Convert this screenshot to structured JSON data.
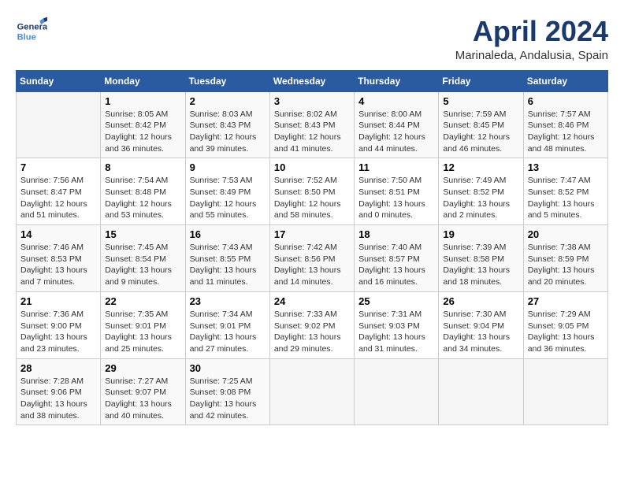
{
  "header": {
    "logo_general": "General",
    "logo_blue": "Blue",
    "month_title": "April 2024",
    "location": "Marinaleda, Andalusia, Spain"
  },
  "columns": [
    "Sunday",
    "Monday",
    "Tuesday",
    "Wednesday",
    "Thursday",
    "Friday",
    "Saturday"
  ],
  "weeks": [
    [
      {
        "day": "",
        "info": ""
      },
      {
        "day": "1",
        "info": "Sunrise: 8:05 AM\nSunset: 8:42 PM\nDaylight: 12 hours\nand 36 minutes."
      },
      {
        "day": "2",
        "info": "Sunrise: 8:03 AM\nSunset: 8:43 PM\nDaylight: 12 hours\nand 39 minutes."
      },
      {
        "day": "3",
        "info": "Sunrise: 8:02 AM\nSunset: 8:43 PM\nDaylight: 12 hours\nand 41 minutes."
      },
      {
        "day": "4",
        "info": "Sunrise: 8:00 AM\nSunset: 8:44 PM\nDaylight: 12 hours\nand 44 minutes."
      },
      {
        "day": "5",
        "info": "Sunrise: 7:59 AM\nSunset: 8:45 PM\nDaylight: 12 hours\nand 46 minutes."
      },
      {
        "day": "6",
        "info": "Sunrise: 7:57 AM\nSunset: 8:46 PM\nDaylight: 12 hours\nand 48 minutes."
      }
    ],
    [
      {
        "day": "7",
        "info": "Sunrise: 7:56 AM\nSunset: 8:47 PM\nDaylight: 12 hours\nand 51 minutes."
      },
      {
        "day": "8",
        "info": "Sunrise: 7:54 AM\nSunset: 8:48 PM\nDaylight: 12 hours\nand 53 minutes."
      },
      {
        "day": "9",
        "info": "Sunrise: 7:53 AM\nSunset: 8:49 PM\nDaylight: 12 hours\nand 55 minutes."
      },
      {
        "day": "10",
        "info": "Sunrise: 7:52 AM\nSunset: 8:50 PM\nDaylight: 12 hours\nand 58 minutes."
      },
      {
        "day": "11",
        "info": "Sunrise: 7:50 AM\nSunset: 8:51 PM\nDaylight: 13 hours\nand 0 minutes."
      },
      {
        "day": "12",
        "info": "Sunrise: 7:49 AM\nSunset: 8:52 PM\nDaylight: 13 hours\nand 2 minutes."
      },
      {
        "day": "13",
        "info": "Sunrise: 7:47 AM\nSunset: 8:52 PM\nDaylight: 13 hours\nand 5 minutes."
      }
    ],
    [
      {
        "day": "14",
        "info": "Sunrise: 7:46 AM\nSunset: 8:53 PM\nDaylight: 13 hours\nand 7 minutes."
      },
      {
        "day": "15",
        "info": "Sunrise: 7:45 AM\nSunset: 8:54 PM\nDaylight: 13 hours\nand 9 minutes."
      },
      {
        "day": "16",
        "info": "Sunrise: 7:43 AM\nSunset: 8:55 PM\nDaylight: 13 hours\nand 11 minutes."
      },
      {
        "day": "17",
        "info": "Sunrise: 7:42 AM\nSunset: 8:56 PM\nDaylight: 13 hours\nand 14 minutes."
      },
      {
        "day": "18",
        "info": "Sunrise: 7:40 AM\nSunset: 8:57 PM\nDaylight: 13 hours\nand 16 minutes."
      },
      {
        "day": "19",
        "info": "Sunrise: 7:39 AM\nSunset: 8:58 PM\nDaylight: 13 hours\nand 18 minutes."
      },
      {
        "day": "20",
        "info": "Sunrise: 7:38 AM\nSunset: 8:59 PM\nDaylight: 13 hours\nand 20 minutes."
      }
    ],
    [
      {
        "day": "21",
        "info": "Sunrise: 7:36 AM\nSunset: 9:00 PM\nDaylight: 13 hours\nand 23 minutes."
      },
      {
        "day": "22",
        "info": "Sunrise: 7:35 AM\nSunset: 9:01 PM\nDaylight: 13 hours\nand 25 minutes."
      },
      {
        "day": "23",
        "info": "Sunrise: 7:34 AM\nSunset: 9:01 PM\nDaylight: 13 hours\nand 27 minutes."
      },
      {
        "day": "24",
        "info": "Sunrise: 7:33 AM\nSunset: 9:02 PM\nDaylight: 13 hours\nand 29 minutes."
      },
      {
        "day": "25",
        "info": "Sunrise: 7:31 AM\nSunset: 9:03 PM\nDaylight: 13 hours\nand 31 minutes."
      },
      {
        "day": "26",
        "info": "Sunrise: 7:30 AM\nSunset: 9:04 PM\nDaylight: 13 hours\nand 34 minutes."
      },
      {
        "day": "27",
        "info": "Sunrise: 7:29 AM\nSunset: 9:05 PM\nDaylight: 13 hours\nand 36 minutes."
      }
    ],
    [
      {
        "day": "28",
        "info": "Sunrise: 7:28 AM\nSunset: 9:06 PM\nDaylight: 13 hours\nand 38 minutes."
      },
      {
        "day": "29",
        "info": "Sunrise: 7:27 AM\nSunset: 9:07 PM\nDaylight: 13 hours\nand 40 minutes."
      },
      {
        "day": "30",
        "info": "Sunrise: 7:25 AM\nSunset: 9:08 PM\nDaylight: 13 hours\nand 42 minutes."
      },
      {
        "day": "",
        "info": ""
      },
      {
        "day": "",
        "info": ""
      },
      {
        "day": "",
        "info": ""
      },
      {
        "day": "",
        "info": ""
      }
    ]
  ]
}
